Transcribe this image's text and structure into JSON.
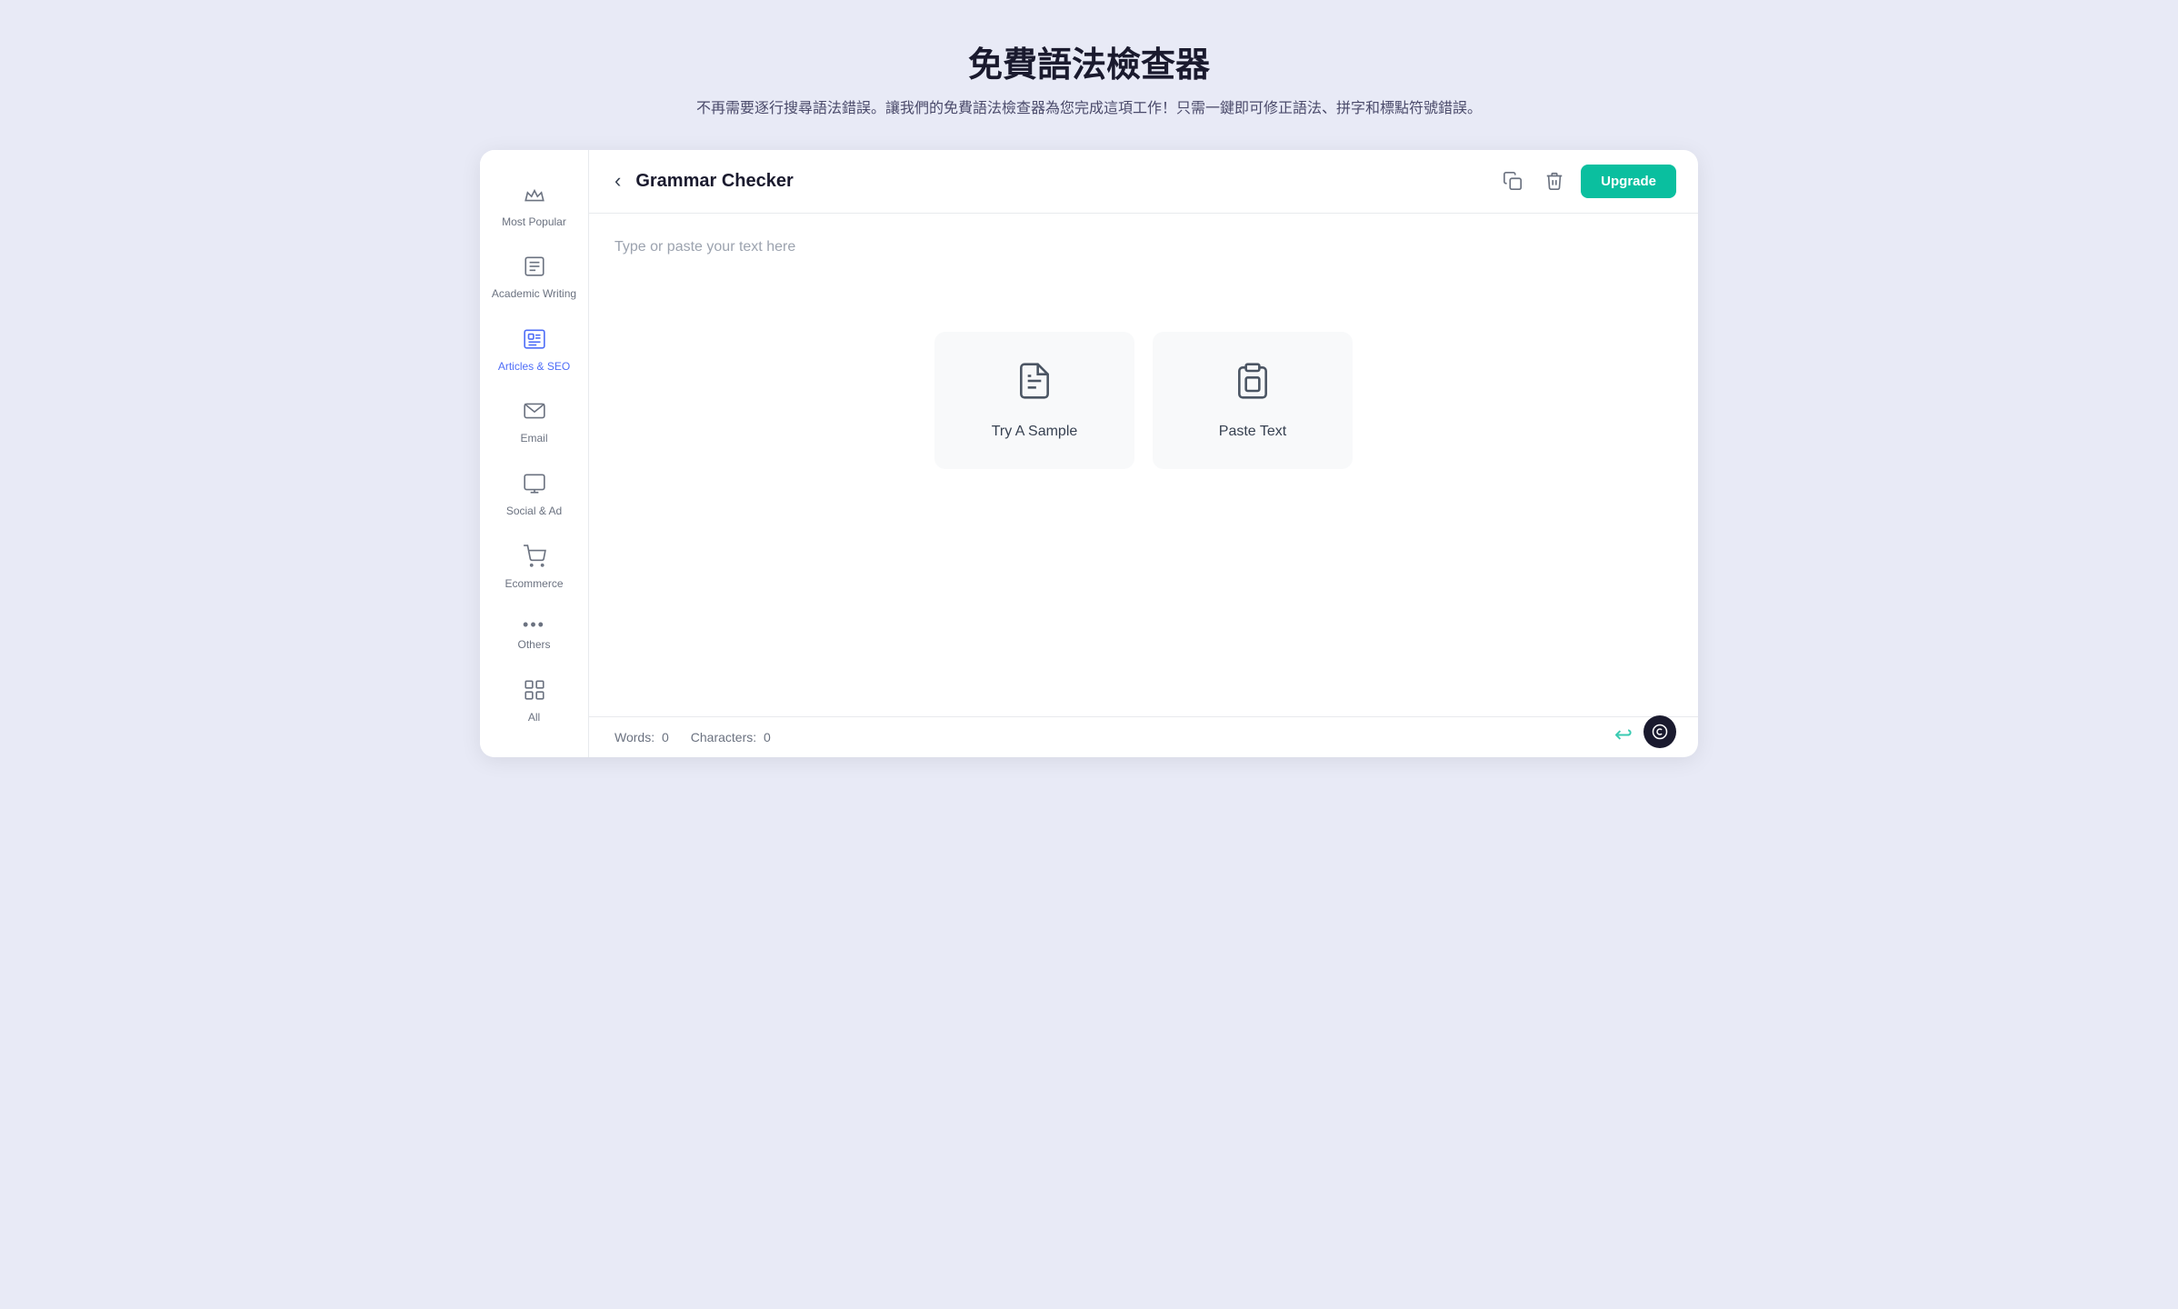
{
  "page": {
    "title": "免費語法檢查器",
    "subtitle": "不再需要逐行搜尋語法錯誤。讓我們的免費語法檢查器為您完成這項工作！只需一鍵即可修正語法、拼字和標點符號錯誤。"
  },
  "toolbar": {
    "back_icon": "‹",
    "title": "Grammar Checker",
    "copy_icon": "⧉",
    "delete_icon": "🗑",
    "upgrade_label": "Upgrade"
  },
  "editor": {
    "placeholder": "Type or paste your text here"
  },
  "action_cards": [
    {
      "id": "try-sample",
      "label": "Try A Sample",
      "icon": "📄"
    },
    {
      "id": "paste-text",
      "label": "Paste Text",
      "icon": "⎘"
    }
  ],
  "bottom_bar": {
    "words_label": "Words:",
    "words_count": "0",
    "chars_label": "Characters:",
    "chars_count": "0"
  },
  "sidebar": {
    "items": [
      {
        "id": "most-popular",
        "label": "Most Popular",
        "icon": "👑",
        "active": false
      },
      {
        "id": "academic-writing",
        "label": "Academic Writing",
        "icon": "📰",
        "active": false
      },
      {
        "id": "articles-seo",
        "label": "Articles & SEO",
        "icon": "🖥",
        "active": true
      },
      {
        "id": "email",
        "label": "Email",
        "icon": "✉",
        "active": false
      },
      {
        "id": "social-ad",
        "label": "Social & Ad",
        "icon": "🖥",
        "active": false
      },
      {
        "id": "ecommerce",
        "label": "Ecommerce",
        "icon": "🛒",
        "active": false
      },
      {
        "id": "others",
        "label": "Others",
        "icon": "···",
        "active": false
      },
      {
        "id": "all",
        "label": "All",
        "icon": "⊞",
        "active": false
      }
    ]
  }
}
